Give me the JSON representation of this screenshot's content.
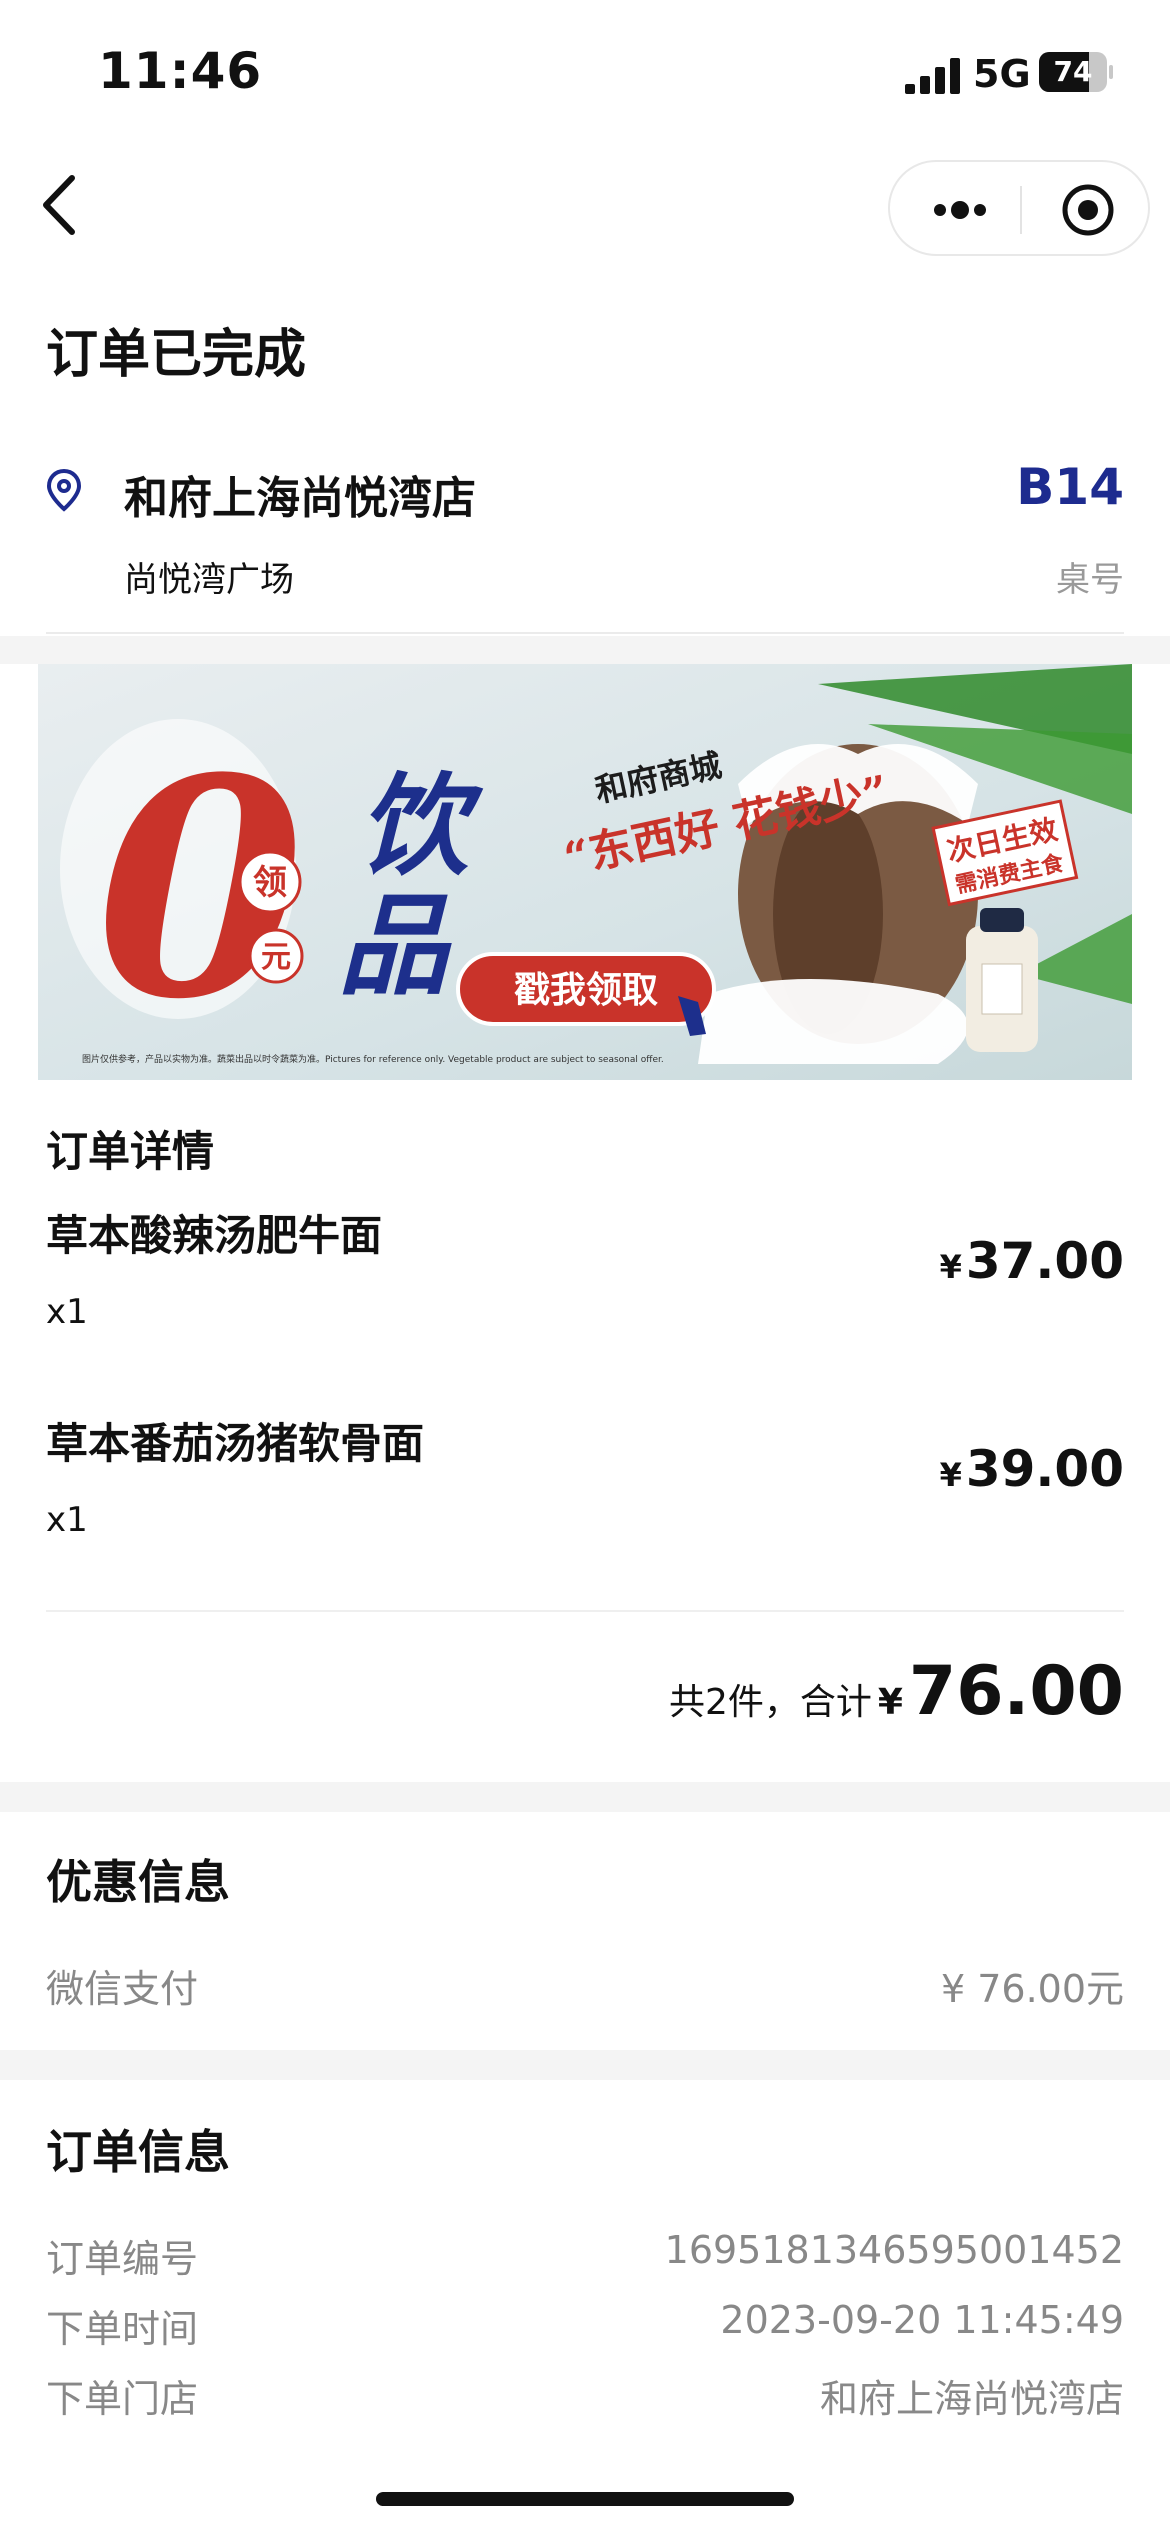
{
  "status_bar": {
    "time": "11:46",
    "network": "5G",
    "battery": "74",
    "battery_level": 0.74
  },
  "nav": {
    "back_icon": "chevron-left-icon",
    "more_icon": "more-dots-icon",
    "close_icon": "target-circle-icon"
  },
  "page_title": "订单已完成",
  "store": {
    "name": "和府上海尚悦湾店",
    "location": "尚悦湾广场",
    "table_number": "B14",
    "table_label": "桌号",
    "icon": "location-pin-icon",
    "accent_color": "#1d2b8f"
  },
  "banner": {
    "zero": "0",
    "ling": "领",
    "yuan": "元",
    "yin": "饮",
    "pin": "品",
    "mall": "和府商城",
    "slogan": "“东西好 花钱少”",
    "button": "戳我领取",
    "stamp_line1": "次日生效",
    "stamp_line2": "需消费主食",
    "disclaimer": "图片仅供参考，产品以实物为准。蔬菜出品以时令蔬菜为准。Pictures for reference only. Vegetable product are subject to seasonal offer.",
    "accent_color": "#c9332a",
    "blue_color": "#1d2f8c"
  },
  "order_detail": {
    "title": "订单详情",
    "currency": "¥",
    "items": [
      {
        "name": "草本酸辣汤肥牛面",
        "qty": "x1",
        "price": "37.00"
      },
      {
        "name": "草本番茄汤猪软骨面",
        "qty": "x1",
        "price": "39.00"
      }
    ],
    "total_label": "共2件，合计",
    "total_amount": "76.00"
  },
  "discount": {
    "title": "优惠信息",
    "method": "微信支付",
    "amount": "¥ 76.00元"
  },
  "order_info": {
    "title": "订单信息",
    "rows": [
      {
        "label": "订单编号",
        "value": "1695181346595001452"
      },
      {
        "label": "下单时间",
        "value": "2023-09-20 11:45:49"
      },
      {
        "label": "下单门店",
        "value": "和府上海尚悦湾店"
      }
    ]
  }
}
